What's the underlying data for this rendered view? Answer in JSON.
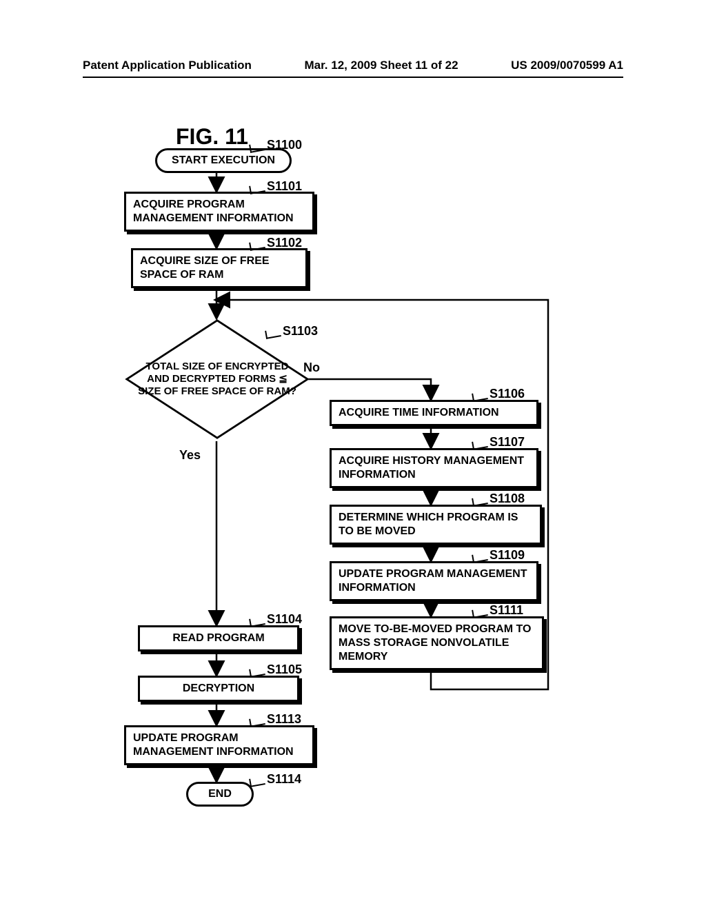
{
  "header": {
    "left": "Patent Application Publication",
    "center": "Mar. 12, 2009  Sheet 11 of 22",
    "right": "US 2009/0070599 A1"
  },
  "figure_title": "FIG. 11",
  "steps": {
    "s1100": {
      "id": "S1100",
      "text": "START EXECUTION"
    },
    "s1101": {
      "id": "S1101",
      "text": "ACQUIRE PROGRAM MANAGEMENT INFORMATION"
    },
    "s1102": {
      "id": "S1102",
      "text": "ACQUIRE SIZE OF FREE SPACE OF RAM"
    },
    "s1103": {
      "id": "S1103",
      "text": "TOTAL SIZE OF ENCRYPTED AND DECRYPTED FORMS ≦ SIZE OF FREE SPACE OF RAM?"
    },
    "s1104": {
      "id": "S1104",
      "text": "READ PROGRAM"
    },
    "s1105": {
      "id": "S1105",
      "text": "DECRYPTION"
    },
    "s1106": {
      "id": "S1106",
      "text": "ACQUIRE TIME INFORMATION"
    },
    "s1107": {
      "id": "S1107",
      "text": "ACQUIRE HISTORY MANAGEMENT INFORMATION"
    },
    "s1108": {
      "id": "S1108",
      "text": "DETERMINE WHICH PROGRAM IS TO BE MOVED"
    },
    "s1109": {
      "id": "S1109",
      "text": "UPDATE PROGRAM MANAGEMENT INFORMATION"
    },
    "s1111": {
      "id": "S1111",
      "text": "MOVE TO-BE-MOVED PROGRAM TO MASS STORAGE NONVOLATILE MEMORY"
    },
    "s1113": {
      "id": "S1113",
      "text": "UPDATE PROGRAM MANAGEMENT INFORMATION"
    },
    "s1114": {
      "id": "S1114",
      "text": "END"
    }
  },
  "edges": {
    "yes": "Yes",
    "no": "No"
  }
}
